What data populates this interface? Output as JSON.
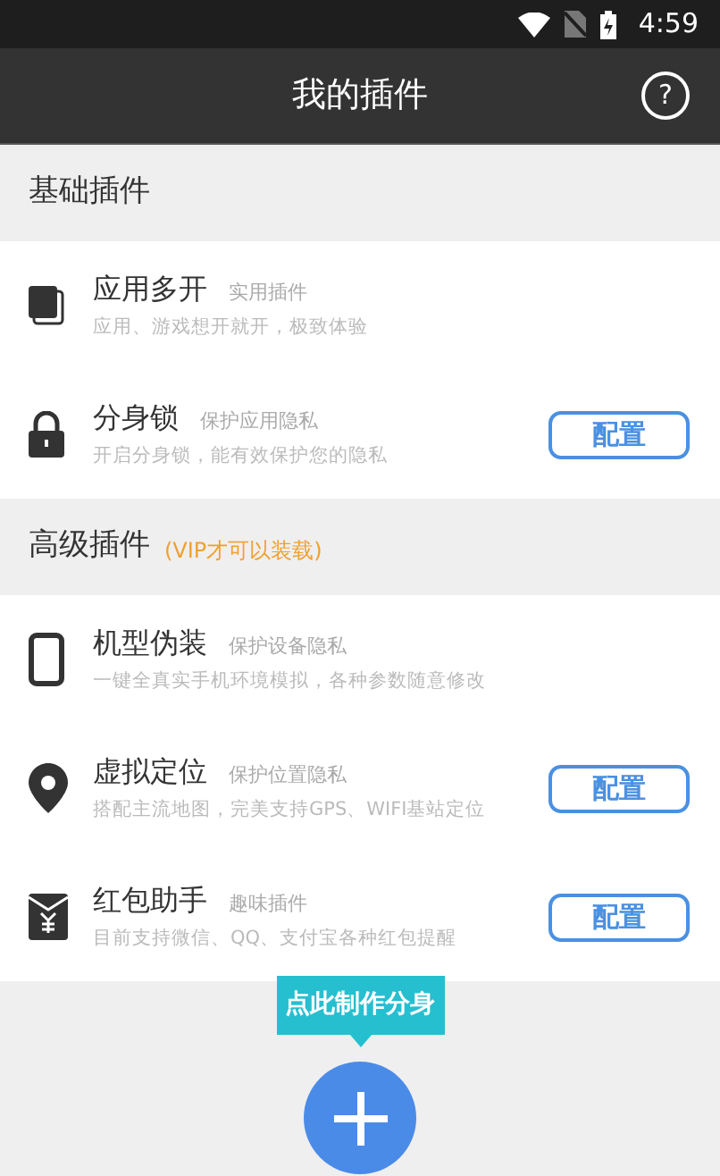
{
  "status_bar": {
    "time": "4:59"
  },
  "header": {
    "title": "我的插件",
    "help": "?"
  },
  "sections": [
    {
      "title": "基础插件",
      "items": [
        {
          "kind": "copy",
          "name": "应用多开",
          "tag": "实用插件",
          "description": "应用、游戏想开就开，极致体验"
        },
        {
          "kind": "lock",
          "name": "分身锁",
          "tag": "保护应用隐私",
          "description": "开启分身锁，能有效保护您的隐私",
          "button": "配置"
        }
      ]
    },
    {
      "title": "高级插件",
      "note": "(VIP才可以装载)",
      "items": [
        {
          "kind": "phone",
          "name": "机型伪装",
          "tag": "保护设备隐私",
          "description": "一键全真实手机环境模拟，各种参数随意修改"
        },
        {
          "kind": "pin",
          "name": "虚拟定位",
          "tag": "保护位置隐私",
          "description": "搭配主流地图，完美支持GPS、WIFI基站定位",
          "button": "配置"
        },
        {
          "kind": "envelope",
          "name": "红包助手",
          "tag": "趣味插件",
          "description": "目前支持微信、QQ、支付宝各种红包提醒",
          "button": "配置"
        }
      ]
    }
  ],
  "tooltip": "点此制作分身"
}
